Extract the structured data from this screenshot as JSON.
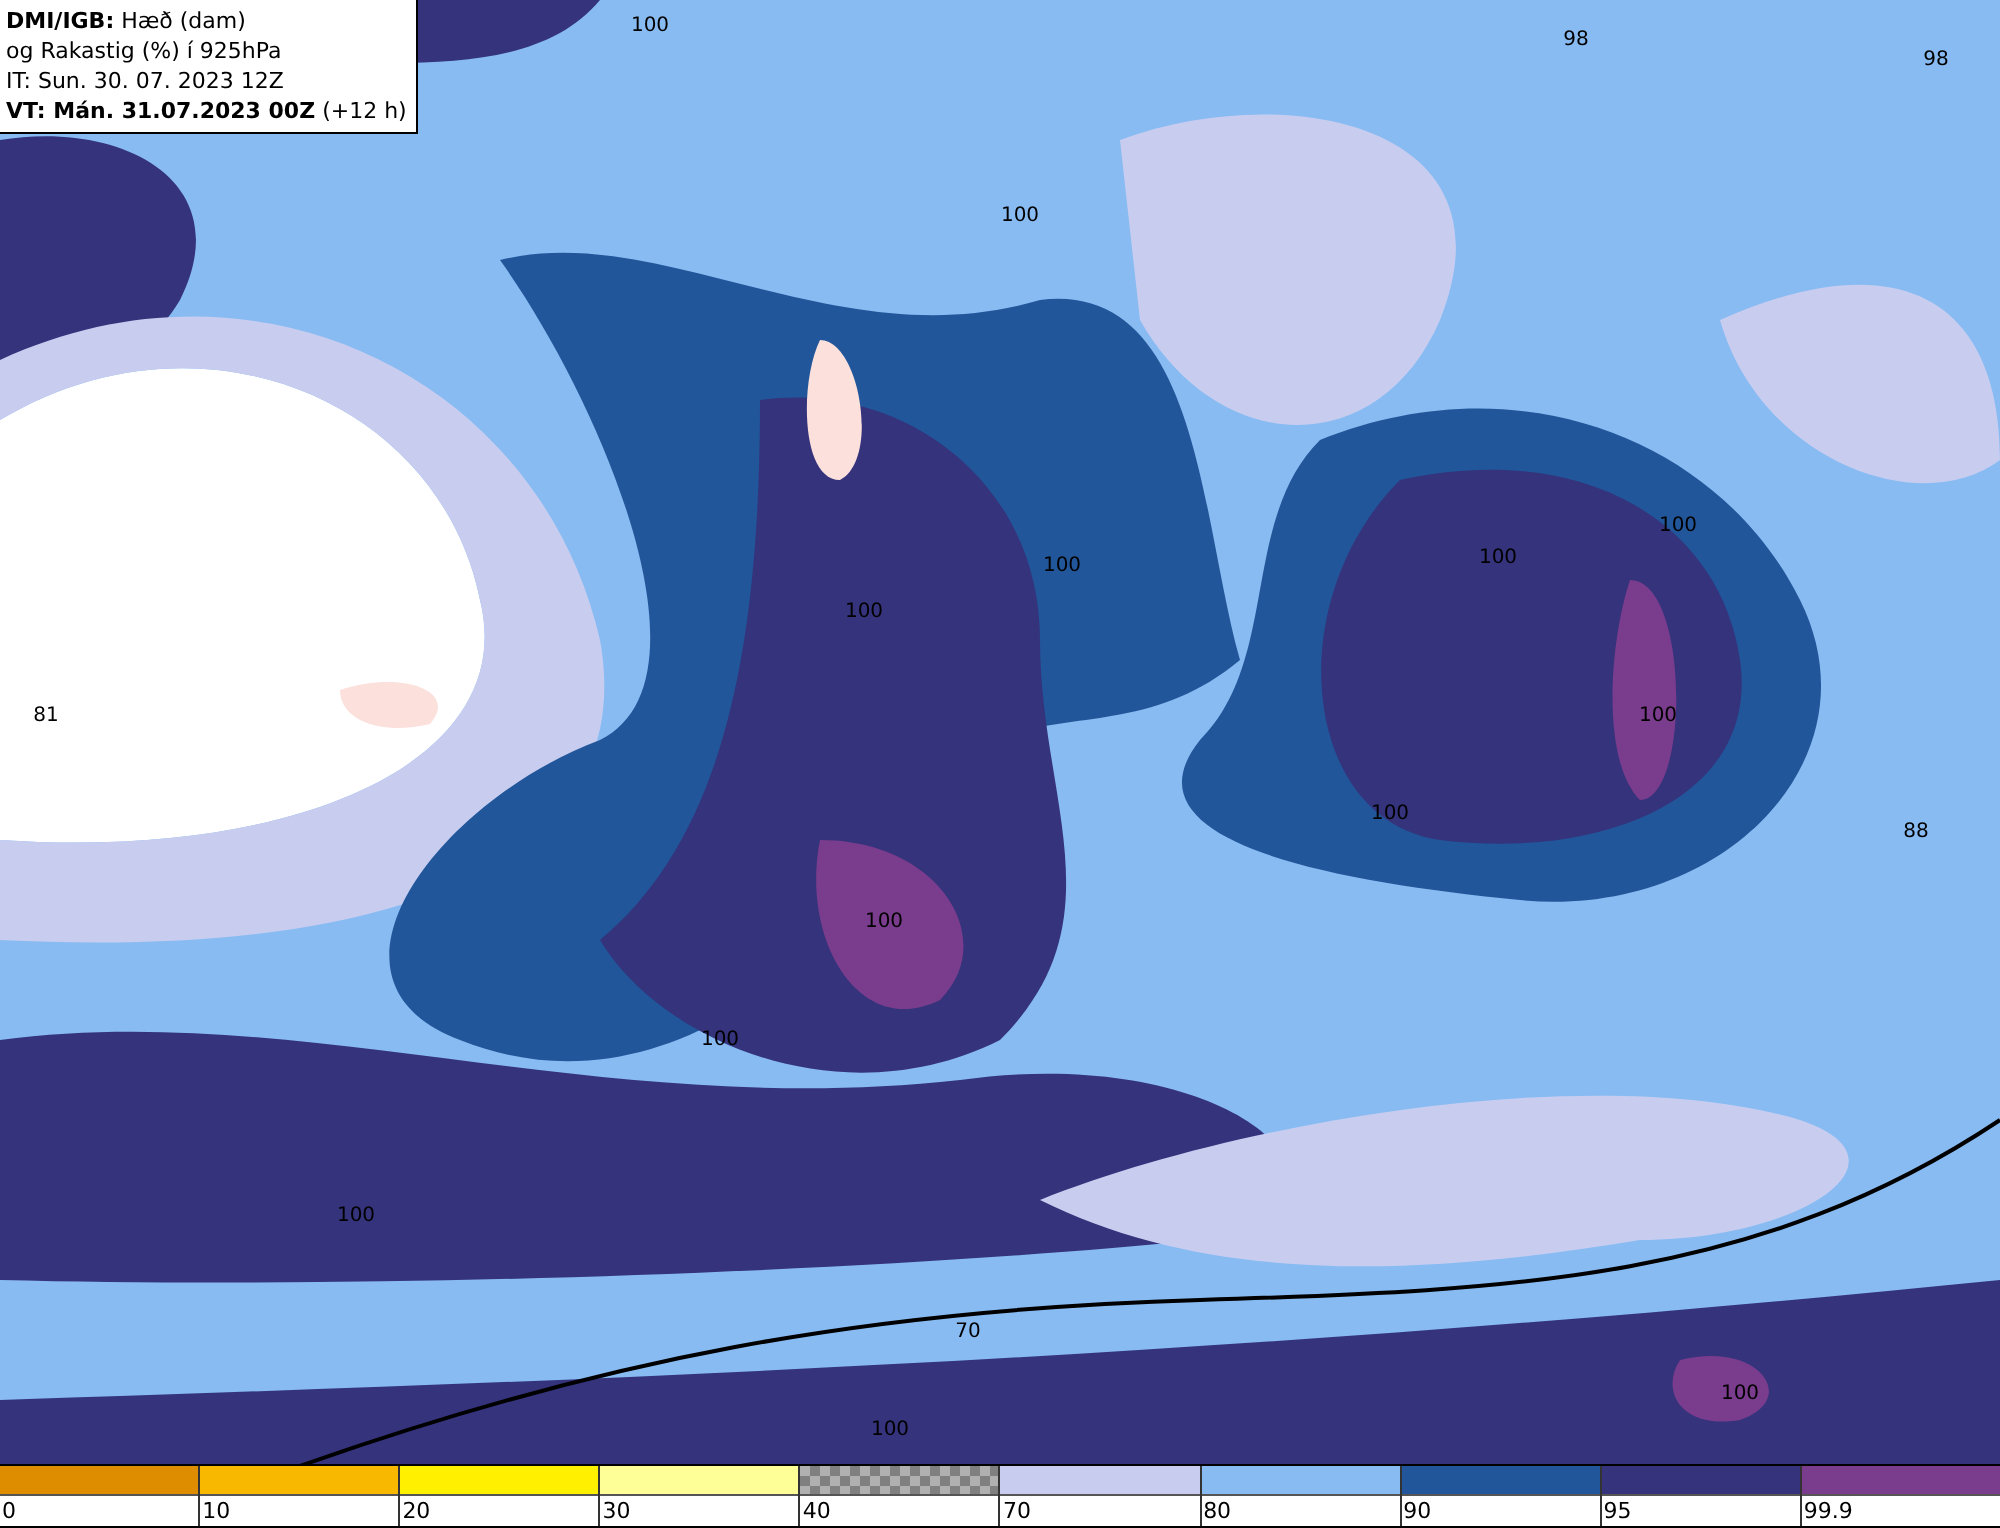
{
  "info_box": {
    "title": "DMI/IGB:",
    "title_rest": "Hæð (dam)",
    "line_2": "og Rakastig (%) í 925hPa",
    "line_3": "IT: Sun. 30. 07. 2023 12Z",
    "valid_bold": "VT: Mán. 31.07.2023 00Z",
    "valid_rest": "(+12 h)"
  },
  "map": {
    "contour_labels": [
      "100",
      "98",
      "98",
      "100",
      "100",
      "100",
      "100",
      "100",
      "100",
      "81",
      "100",
      "88",
      "100",
      "100",
      "100",
      "70",
      "100",
      "100"
    ]
  },
  "legend": [
    {
      "label": "0",
      "color": "#de8c00",
      "kind": "solid"
    },
    {
      "label": "10",
      "color": "#f8b800",
      "kind": "solid"
    },
    {
      "label": "20",
      "color": "#fff000",
      "kind": "solid"
    },
    {
      "label": "30",
      "color": "#ffff98",
      "kind": "solid"
    },
    {
      "label": "40",
      "color": "#808080",
      "kind": "checker"
    },
    {
      "label": "70",
      "color": "#c8cdf0",
      "kind": "solid"
    },
    {
      "label": "80",
      "color": "#88bbf2",
      "kind": "solid"
    },
    {
      "label": "90",
      "color": "#22569a",
      "kind": "solid"
    },
    {
      "label": "95",
      "color": "#34337c",
      "kind": "solid"
    },
    {
      "label": "99.9",
      "color": "#7a3c8c",
      "kind": "solid"
    }
  ]
}
